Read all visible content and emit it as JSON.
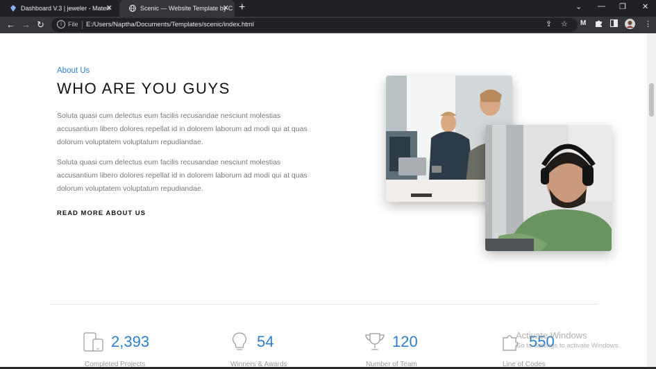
{
  "browser": {
    "tabs": [
      {
        "title": "Dashboard V.3 | jeweler - Materi",
        "close": "✕"
      },
      {
        "title": "Scenic — Website Template by C",
        "close": "✕"
      }
    ],
    "new_tab": "+",
    "window_controls": {
      "menu": "⌄",
      "minimize": "—",
      "restore": "❐",
      "close": "✕"
    },
    "nav": {
      "back": "←",
      "forward": "→",
      "reload": "↻"
    },
    "address": {
      "scheme_label": "File",
      "url": "E:/Users/Naptha/Documents/Templates/scenic/index.html"
    },
    "toolbar_icons": [
      "share-icon",
      "star-icon",
      "extension-m-icon",
      "puzzle-icon",
      "sidebar-icon",
      "avatar",
      "kebab-menu-icon"
    ]
  },
  "about": {
    "eyebrow": "About Us",
    "heading": "WHO ARE YOU GUYS",
    "paragraphs": [
      "Soluta quasi cum delectus eum facilis recusandae nesciunt molestias accusantium libero dolores repellat id in dolorem laborum ad modi qui at quas dolorum voluptatem voluptatum repudiandae.",
      "Soluta quasi cum delectus eum facilis recusandae nesciunt molestias accusantium libero dolores repellat id in dolorem laborum ad modi qui at quas dolorum voluptatem voluptatum repudiandae."
    ],
    "read_more": "READ MORE ABOUT US"
  },
  "stats": [
    {
      "icon": "devices-icon",
      "value": "2,393",
      "label": "Completed Projects"
    },
    {
      "icon": "lightbulb-icon",
      "value": "54",
      "label": "Winners & Awards"
    },
    {
      "icon": "trophy-icon",
      "value": "120",
      "label": "Number of Team"
    },
    {
      "icon": "puzzle-piece-icon",
      "value": "550",
      "label": "Line of Codes"
    }
  ],
  "watermark": {
    "title": "Activate Windows",
    "subtitle": "Go to Settings to activate Windows."
  },
  "colors": {
    "accent": "#2a7fcf",
    "chrome_dark": "#202124",
    "chrome_toolbar": "#35363a"
  }
}
